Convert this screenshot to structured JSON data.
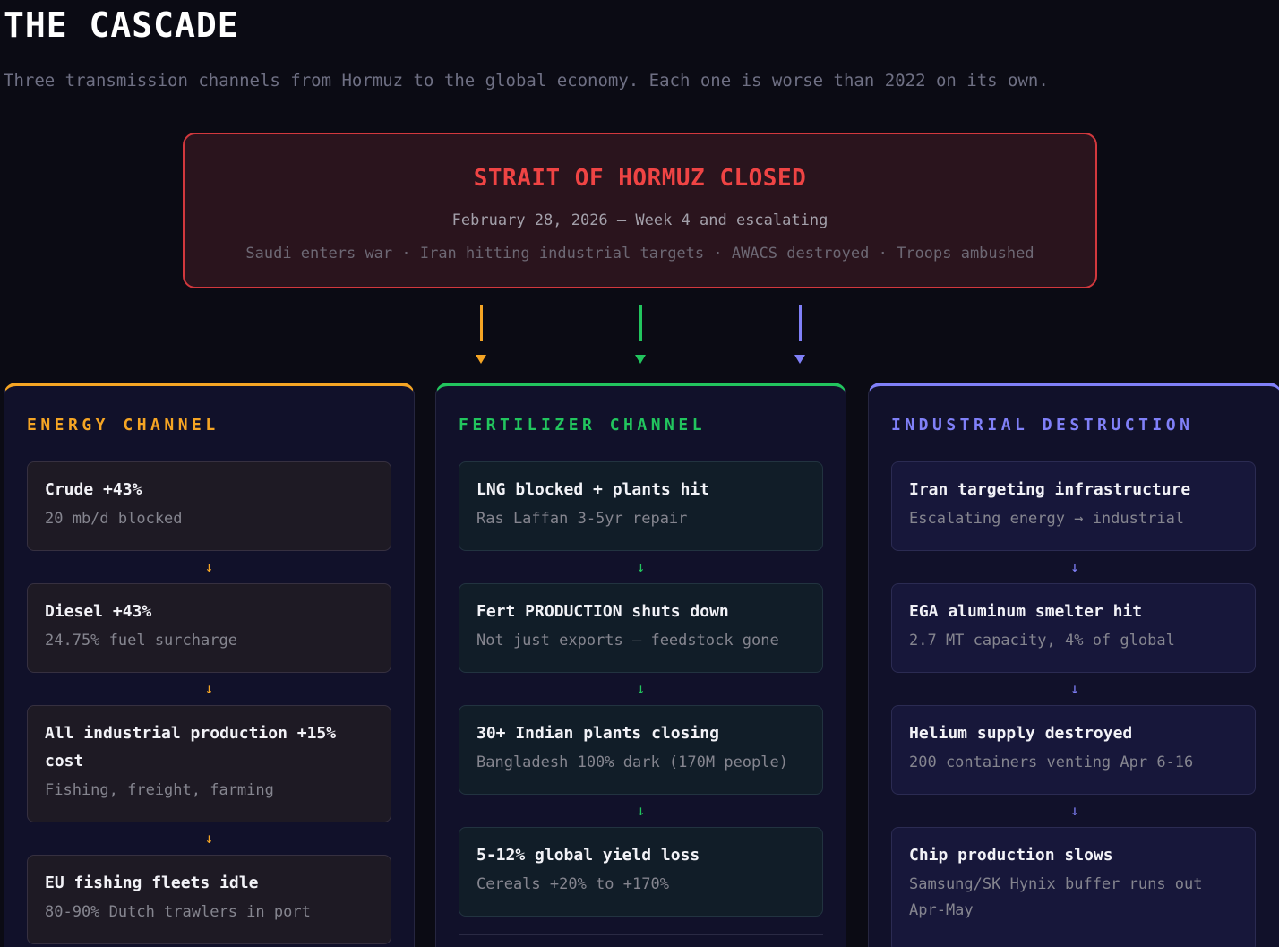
{
  "header": {
    "title": "THE CASCADE",
    "subtitle": "Three transmission channels from Hormuz to the global economy. Each one is worse than 2022 on its own."
  },
  "origin": {
    "title": "STRAIT OF HORMUZ CLOSED",
    "date": "February 28, 2026 — Week 4 and escalating",
    "events": "Saudi enters war · Iran hitting industrial targets · AWACS destroyed · Troops ambushed"
  },
  "arrow_glyph": "↓",
  "channels": [
    {
      "title": "ENERGY CHANNEL",
      "color": "#f5a524",
      "cards": [
        {
          "title": "Crude +43%",
          "sub": "20 mb/d blocked"
        },
        {
          "title": "Diesel +43%",
          "sub": "24.75% fuel surcharge"
        },
        {
          "title": "All industrial production +15% cost",
          "sub": "Fishing, freight, farming"
        },
        {
          "title": "EU fishing fleets idle",
          "sub": "80-90% Dutch trawlers in port"
        }
      ]
    },
    {
      "title": "FERTILIZER CHANNEL",
      "color": "#22c55e",
      "cards": [
        {
          "title": "LNG blocked + plants hit",
          "sub": "Ras Laffan 3-5yr repair"
        },
        {
          "title": "Fert PRODUCTION shuts down",
          "sub": "Not just exports — feedstock gone"
        },
        {
          "title": "30+ Indian plants closing",
          "sub": "Bangladesh 100% dark (170M people)"
        },
        {
          "title": "5-12% global yield loss",
          "sub": "Cereals +20% to +170%"
        }
      ]
    },
    {
      "title": "INDUSTRIAL DESTRUCTION",
      "color": "#8080f8",
      "cards": [
        {
          "title": "Iran targeting infrastructure",
          "sub": "Escalating energy → industrial"
        },
        {
          "title": "EGA aluminum smelter hit",
          "sub": "2.7 MT capacity, 4% of global"
        },
        {
          "title": "Helium supply destroyed",
          "sub": "200 containers venting Apr 6-16"
        },
        {
          "title": "Chip production slows",
          "sub": "Samsung/SK Hynix buffer runs out Apr-May"
        }
      ]
    }
  ]
}
